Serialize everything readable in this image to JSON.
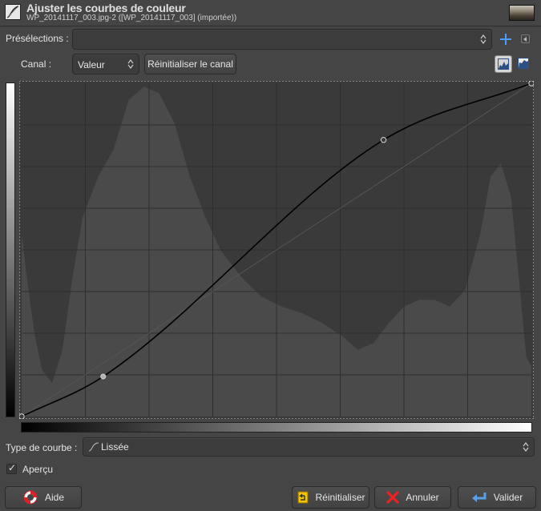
{
  "header": {
    "title": "Ajuster les courbes de couleur",
    "subtitle": "WP_20141117_003.jpg-2 ([WP_20141117_003] (importée))"
  },
  "presets": {
    "label": "Présélections :",
    "value": ""
  },
  "channel": {
    "label": "Canal :",
    "value": "Valeur",
    "reset_label": "Réinitialiser le canal"
  },
  "curve": {
    "points": [
      [
        0,
        0
      ],
      [
        0.16,
        0.12
      ],
      [
        0.71,
        0.83
      ],
      [
        1,
        1
      ]
    ],
    "type_label": "Type de courbe :",
    "type_value": "Lissée"
  },
  "preview": {
    "label": "Aperçu",
    "checked": true
  },
  "buttons": {
    "help": "Aide",
    "reset": "Réinitialiser",
    "cancel": "Annuler",
    "ok": "Valider"
  }
}
